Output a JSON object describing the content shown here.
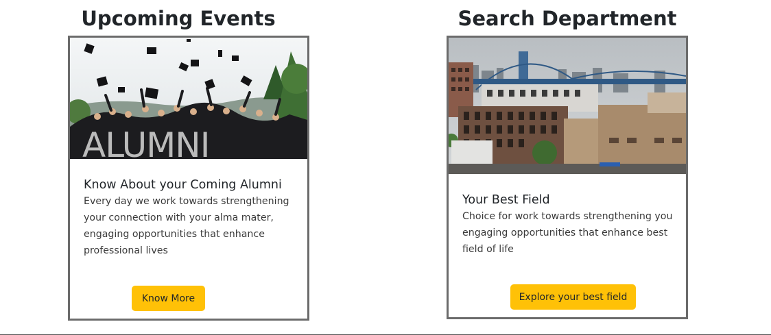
{
  "sections": {
    "left_title": "Upcoming Events",
    "right_title": "Search Department"
  },
  "events_card": {
    "image_text": "ALUMNI",
    "title": "Know About your Coming Alumni",
    "text": "Every day we work towards strengthening your connection with your alma mater, engaging opportunities that enhance professional lives",
    "button_label": "Know More"
  },
  "department_card": {
    "title": "Your Best Field",
    "text": "Choice for work towards strengthening you engaging opportunities that enhance best field of life",
    "button_label": "Explore your best field"
  },
  "colors": {
    "button": "#ffc107",
    "card_border": "#6b6b6b",
    "heading": "#212529"
  }
}
